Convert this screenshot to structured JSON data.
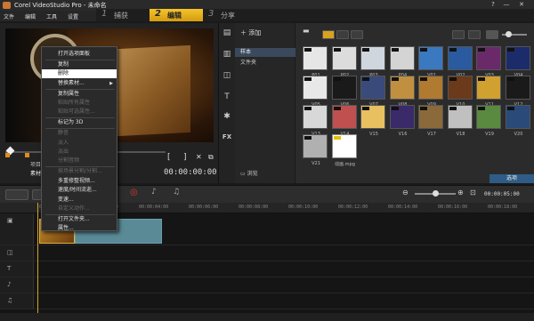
{
  "window": {
    "title": "Corel VideoStudio Pro - 未命名",
    "minimize": "—",
    "help": "?",
    "close": "✕"
  },
  "menu_bar": [
    "文件",
    "编辑",
    "工具",
    "设置"
  ],
  "steps": [
    {
      "num": "1",
      "label": "捕获",
      "active": false
    },
    {
      "num": "2",
      "label": "编辑",
      "active": true
    },
    {
      "num": "3",
      "label": "分享",
      "active": false
    }
  ],
  "preview": {
    "project_label": "项目",
    "clip_label": "素材",
    "timecode": "00:00:00:00",
    "mark_in": "[",
    "mark_out": "]"
  },
  "library": {
    "add_label": "添加",
    "folders": [
      "样本",
      "文件夹"
    ],
    "browse_label": "浏览",
    "options_label": "选项",
    "thumbnails": [
      {
        "cap": "P01"
      },
      {
        "cap": "P02"
      },
      {
        "cap": "P03"
      },
      {
        "cap": "P04"
      },
      {
        "cap": "V01"
      },
      {
        "cap": "V02"
      },
      {
        "cap": "V03"
      },
      {
        "cap": "V04"
      },
      {
        "cap": "V05"
      },
      {
        "cap": "V06"
      },
      {
        "cap": "V07"
      },
      {
        "cap": "V08"
      },
      {
        "cap": "V09"
      },
      {
        "cap": "V10"
      },
      {
        "cap": "V11"
      },
      {
        "cap": "V12"
      },
      {
        "cap": "V13"
      },
      {
        "cap": "V14"
      },
      {
        "cap": "V15"
      },
      {
        "cap": "V16"
      },
      {
        "cap": "V17"
      },
      {
        "cap": "V18"
      },
      {
        "cap": "V19"
      },
      {
        "cap": "V20"
      },
      {
        "cap": "V21"
      },
      {
        "cap": "动画.mpg"
      }
    ]
  },
  "timeline": {
    "timecode": "00:00:05:00",
    "ruler": [
      "00:00:00:00",
      "00:00:02:00",
      "00:00:04:00",
      "00:00:06:00",
      "00:00:08:00",
      "00:00:10:00",
      "00:00:12:00",
      "00:00:14:00",
      "00:00:16:00",
      "00:00:18:00"
    ]
  },
  "context_menu": {
    "items": [
      {
        "label": "打开选项面板",
        "enabled": true
      },
      {
        "label": "复制",
        "enabled": true
      },
      {
        "label": "删除",
        "enabled": true,
        "highlighted": true
      },
      {
        "label": "替换素材...",
        "enabled": true,
        "submenu": true
      },
      {
        "label": "复制属性",
        "enabled": true
      },
      {
        "label": "粘贴所有属性",
        "enabled": false
      },
      {
        "label": "粘贴可选属性...",
        "enabled": false
      },
      {
        "label": "标记为 3D",
        "enabled": true
      },
      {
        "label": "静音",
        "enabled": false
      },
      {
        "label": "淡入",
        "enabled": false
      },
      {
        "label": "淡出",
        "enabled": false
      },
      {
        "label": "分割音频",
        "enabled": false
      },
      {
        "label": "按场景分割/分割...",
        "enabled": false
      },
      {
        "label": "多重修整视频...",
        "enabled": true
      },
      {
        "label": "速度/时间流逝...",
        "enabled": true
      },
      {
        "label": "变速...",
        "enabled": true
      },
      {
        "label": "自定义动作...",
        "enabled": false
      },
      {
        "label": "打开文件夹...",
        "enabled": true
      },
      {
        "label": "属性...",
        "enabled": true
      }
    ]
  }
}
